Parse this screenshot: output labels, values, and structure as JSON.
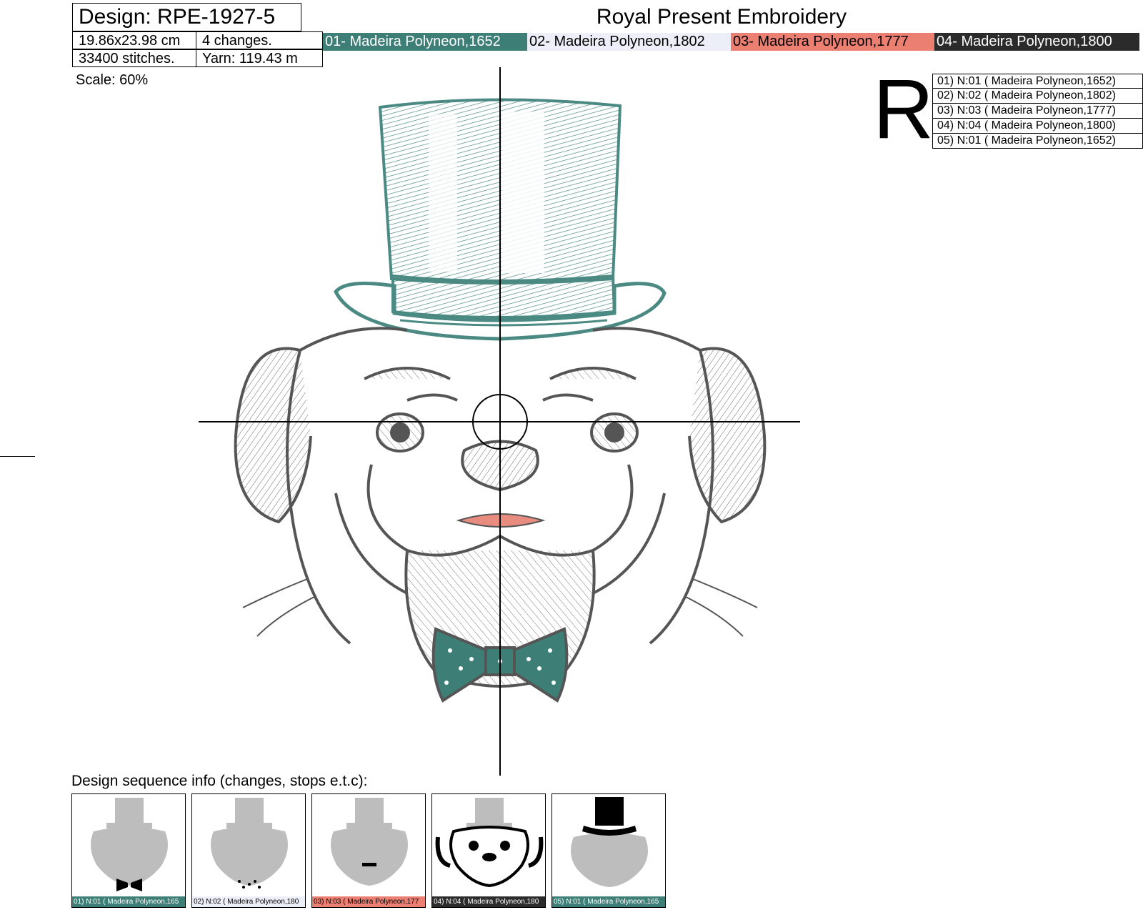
{
  "header": {
    "design_title": "Design: RPE-1927-5",
    "brand": "Royal Present Embroidery",
    "size": "19.86x23.98 cm",
    "changes": "4 changes.",
    "stitches": "33400 stitches.",
    "yarn": "Yarn: 119.43 m",
    "scale": "Scale: 60%"
  },
  "threads": [
    {
      "label": "01- Madeira Polyneon,1652",
      "bg": "#3d7f77",
      "fg": "#ffffff"
    },
    {
      "label": "02- Madeira Polyneon,1802",
      "bg": "#eceef8",
      "fg": "#000000"
    },
    {
      "label": "03- Madeira Polyneon,1777",
      "bg": "#ea7f72",
      "fg": "#000000"
    },
    {
      "label": "04- Madeira Polyneon,1800",
      "bg": "#2b2b2b",
      "fg": "#ffffff"
    }
  ],
  "orientation_letter": "R",
  "legend": [
    "01) N:01 ( Madeira Polyneon,1652)",
    "02) N:02 ( Madeira Polyneon,1802)",
    "03) N:03 ( Madeira Polyneon,1777)",
    "04) N:04 ( Madeira Polyneon,1800)",
    "05) N:01 ( Madeira Polyneon,1652)"
  ],
  "sequence": {
    "title": "Design sequence info (changes, stops e.t.c):",
    "steps": [
      {
        "label": "01) N:01 ( Madeira Polyneon,165",
        "bg": "#3d7f77",
        "fg": "#ffffff",
        "highlight": "bowtie"
      },
      {
        "label": "02) N:02 ( Madeira Polyneon,180",
        "bg": "#eceef8",
        "fg": "#000000",
        "highlight": "dots"
      },
      {
        "label": "03) N:03 ( Madeira Polyneon,177",
        "bg": "#ea7f72",
        "fg": "#000000",
        "highlight": "mouth"
      },
      {
        "label": "04) N:04 ( Madeira Polyneon,180",
        "bg": "#2b2b2b",
        "fg": "#ffffff",
        "highlight": "head"
      },
      {
        "label": "05) N:01 ( Madeira Polyneon,165",
        "bg": "#3d7f77",
        "fg": "#ffffff",
        "highlight": "hat"
      }
    ]
  },
  "colors": {
    "hat": "#4a8a82",
    "line": "#555555",
    "mouth": "#e88c80",
    "bowtie": "#3d7f77"
  }
}
